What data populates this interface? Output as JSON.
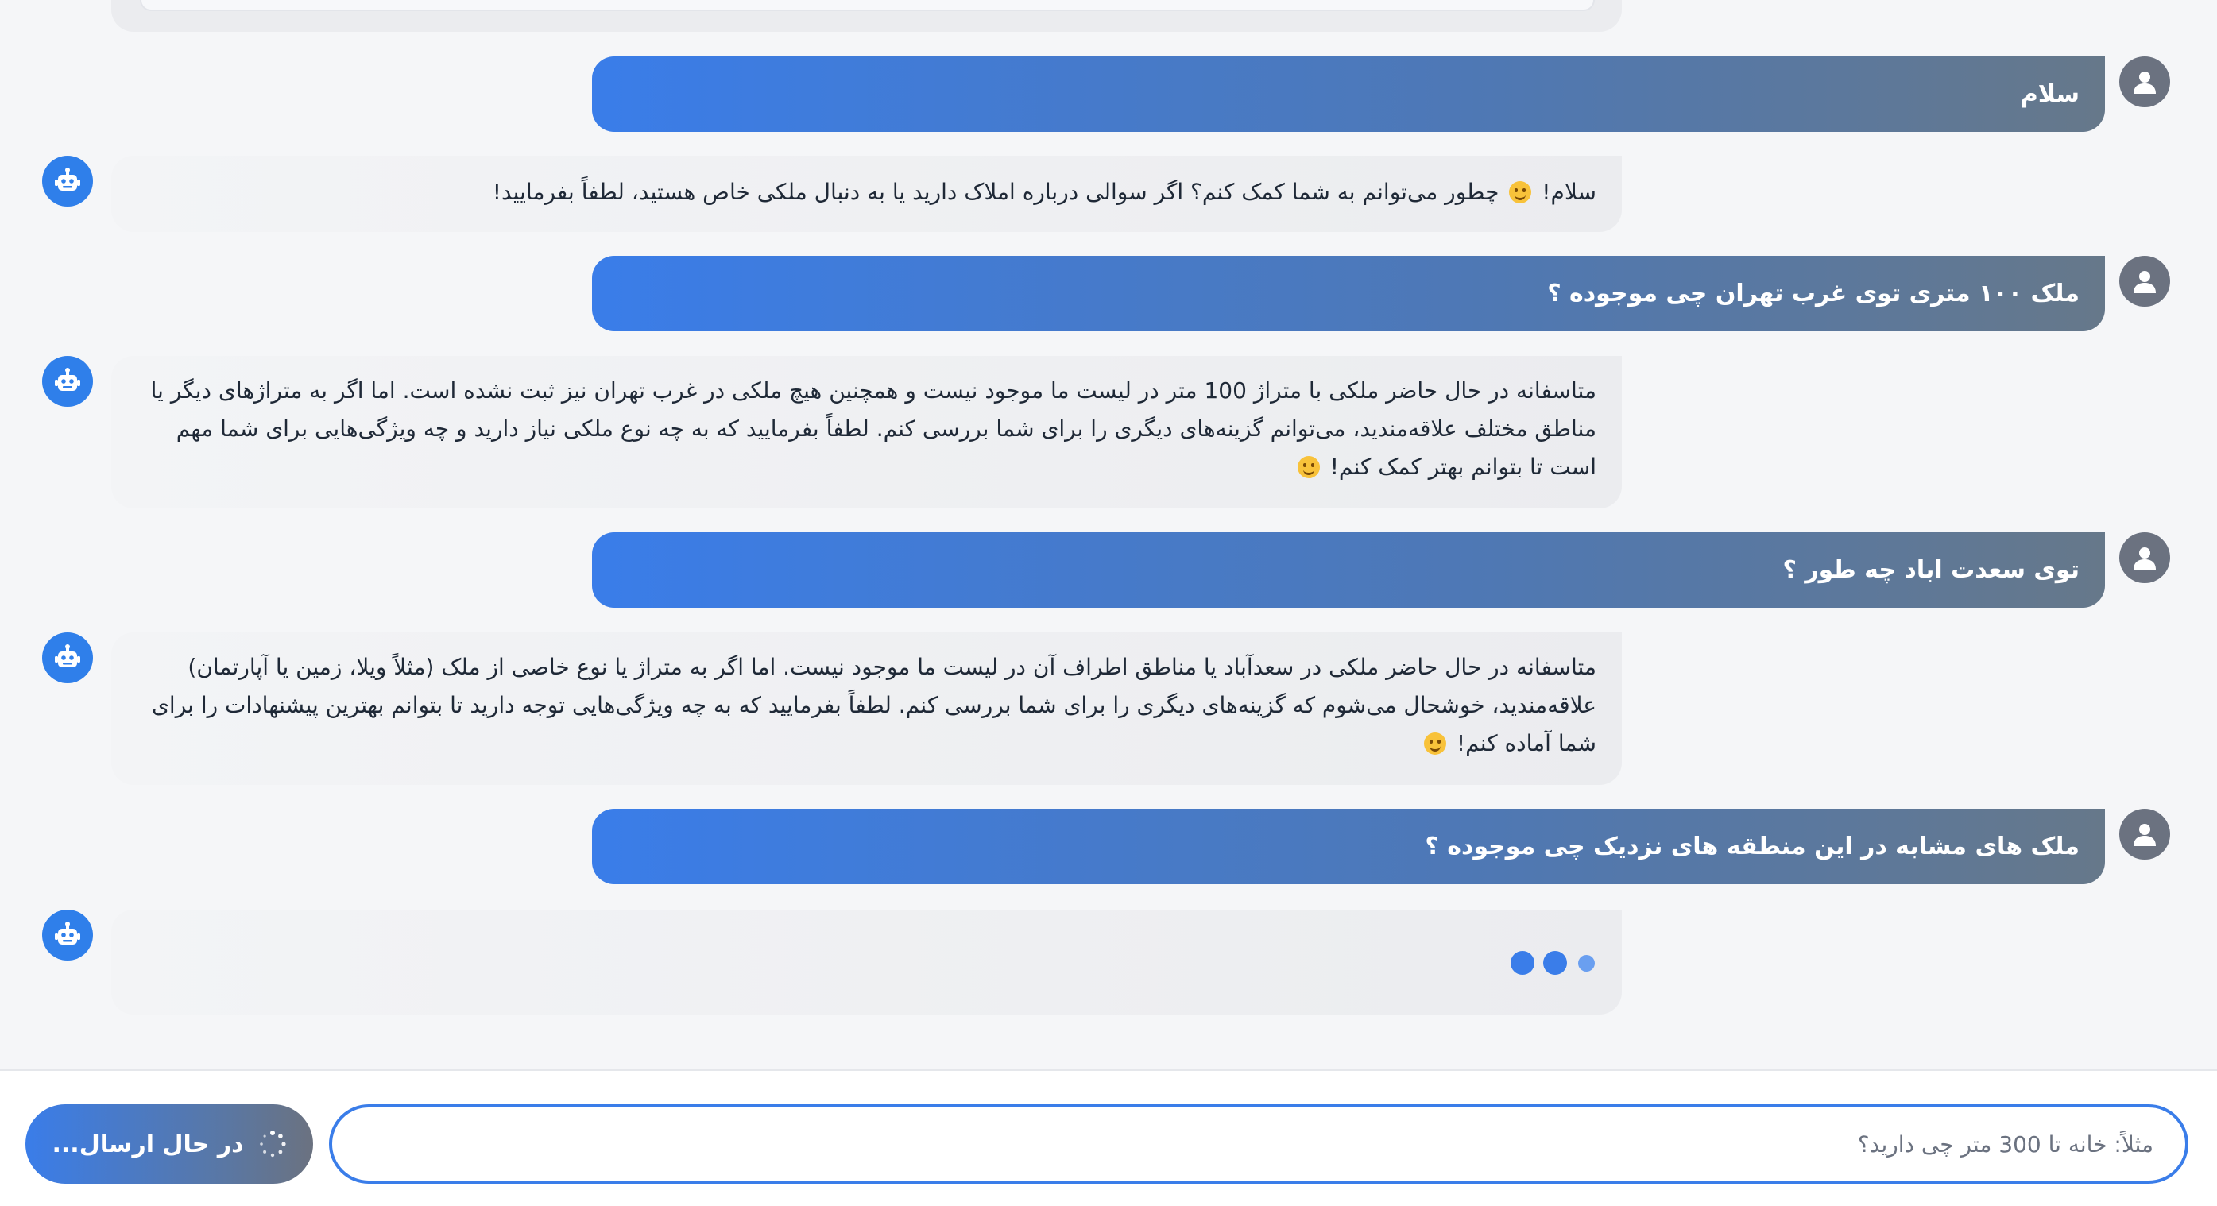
{
  "messages": [
    {
      "role": "user",
      "text": "سلام"
    },
    {
      "role": "bot",
      "text": "سلام! 😊 چطور می‌توانم به شما کمک کنم؟ اگر سوالی درباره املاک دارید یا به دنبال ملکی خاص هستید، لطفاً بفرمایید!"
    },
    {
      "role": "user",
      "text": "ملک ۱۰۰ متری توی غرب تهران چی موجوده ؟"
    },
    {
      "role": "bot",
      "text": "متاسفانه در حال حاضر ملکی با متراژ 100 متر در لیست ما موجود نیست و همچنین هیچ ملکی در غرب تهران نیز ثبت نشده است. اما اگر به متراژهای دیگر یا مناطق مختلف علاقه‌مندید، می‌توانم گزینه‌های دیگری را برای شما بررسی کنم. لطفاً بفرمایید که به چه نوع ملکی نیاز دارید و چه ویژگی‌هایی برای شما مهم است تا بتوانم بهتر کمک کنم! 😊"
    },
    {
      "role": "user",
      "text": "توی سعدت اباد چه طور ؟"
    },
    {
      "role": "bot",
      "text": "متاسفانه در حال حاضر ملکی در سعدآباد یا مناطق اطراف آن در لیست ما موجود نیست. اما اگر به متراژ یا نوع خاصی از ملک (مثلاً ویلا، زمین یا آپارتمان) علاقه‌مندید، خوشحال می‌شوم که گزینه‌های دیگری را برای شما بررسی کنم. لطفاً بفرمایید که به چه ویژگی‌هایی توجه دارید تا بتوانم بهترین پیشنهادات را برای شما آماده کنم! 😊"
    },
    {
      "role": "user",
      "text": "ملک های مشابه در این منطقه های نزدیک چی موجوده ؟"
    }
  ],
  "bot_typing": true,
  "composer": {
    "placeholder": "مثلاً: خانه تا 300 متر چی دارید؟",
    "value": "",
    "send_label": "در حال ارسال...",
    "send_state": "loading"
  },
  "icons": {
    "user_avatar": "user-icon",
    "bot_avatar": "robot-icon",
    "send_spinner": "spinner-icon"
  },
  "colors": {
    "accent": "#3a7de9",
    "user_bubble_end": "#66788a",
    "bot_avatar": "#2f7fea",
    "user_avatar": "#6b7280"
  }
}
